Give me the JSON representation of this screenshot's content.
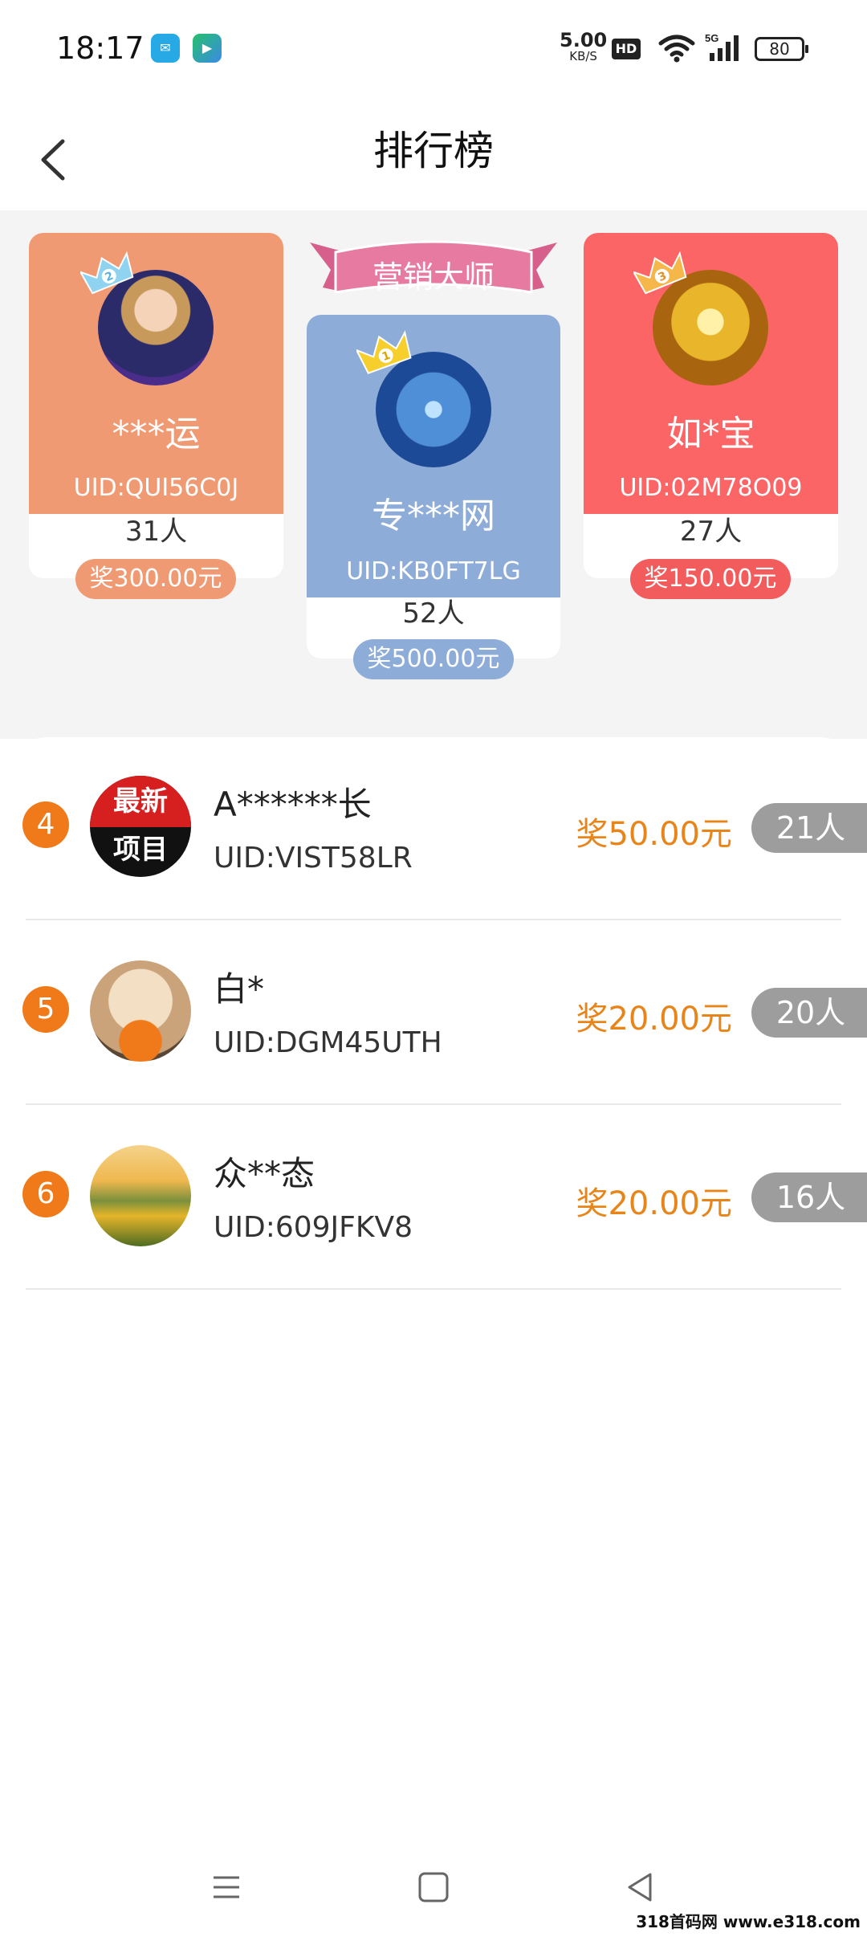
{
  "status": {
    "time": "18:17",
    "speed_value": "5.00",
    "speed_unit": "KB/S",
    "hd": "HD",
    "network": "5G",
    "battery": "80"
  },
  "header": {
    "title": "排行榜"
  },
  "podium": {
    "banner": "营销大师",
    "first": {
      "rank": "1",
      "name": "专***网",
      "uid": "UID:KB0FT7LG",
      "count": "52人",
      "prize": "奖500.00元",
      "color": "#8eacd8",
      "prize_color": "#8eacd8"
    },
    "second": {
      "rank": "2",
      "name": "***运",
      "uid": "UID:QUI56C0J",
      "count": "31人",
      "prize": "奖300.00元",
      "color": "#ef9a73",
      "prize_color": "#ef9a73"
    },
    "third": {
      "rank": "3",
      "name": "如*宝",
      "uid": "UID:02M78O09",
      "count": "27人",
      "prize": "奖150.00元",
      "color": "#fb6565",
      "prize_color": "#f25c5c"
    }
  },
  "list": [
    {
      "rank": "4",
      "name": "A******长",
      "uid": "UID:VIST58LR",
      "prize": "奖50.00元",
      "count": "21人",
      "avatar_text_1": "最新",
      "avatar_text_2": "项目"
    },
    {
      "rank": "5",
      "name": "白*",
      "uid": "UID:DGM45UTH",
      "prize": "奖20.00元",
      "count": "20人"
    },
    {
      "rank": "6",
      "name": "众**态",
      "uid": "UID:609JFKV8",
      "prize": "奖20.00元",
      "count": "16人"
    }
  ],
  "watermark": "318首码网 www.e318.com",
  "colors": {
    "accent": "#f07a1a",
    "prize_text": "#e8851a",
    "banner": "#e77aa0"
  }
}
